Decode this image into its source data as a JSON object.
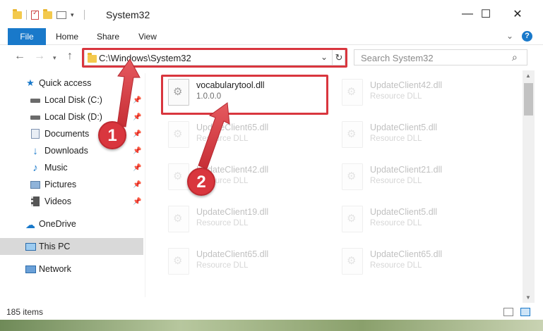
{
  "window": {
    "title": "System32"
  },
  "title_buttons": {
    "minimize": "—",
    "maximize": "☐",
    "close": "✕"
  },
  "ribbon": {
    "tabs": [
      "File",
      "Home",
      "Share",
      "View"
    ],
    "expand": "⌄",
    "help": "?"
  },
  "address": {
    "path": "C:\\Windows\\System32",
    "dropdown": "⌄",
    "refresh": "↻"
  },
  "search": {
    "placeholder": "Search System32"
  },
  "navpane": {
    "items": [
      {
        "label": "Quick access",
        "icon": "star-icon",
        "pinned": false
      },
      {
        "label": "Local Disk (C:)",
        "icon": "drive-icon",
        "pinned": true
      },
      {
        "label": "Local Disk (D:)",
        "icon": "drive-icon",
        "pinned": true
      },
      {
        "label": "Documents",
        "icon": "documents-icon",
        "pinned": true
      },
      {
        "label": "Downloads",
        "icon": "download-icon",
        "pinned": true
      },
      {
        "label": "Music",
        "icon": "music-icon",
        "pinned": true
      },
      {
        "label": "Pictures",
        "icon": "pictures-icon",
        "pinned": true
      },
      {
        "label": "Videos",
        "icon": "videos-icon",
        "pinned": true
      },
      {
        "label": "OneDrive",
        "icon": "cloud-icon",
        "pinned": false
      },
      {
        "label": "This PC",
        "icon": "computer-icon",
        "pinned": false,
        "selected": true
      },
      {
        "label": "Network",
        "icon": "network-icon",
        "pinned": false
      }
    ]
  },
  "files": [
    {
      "name": "vocabularytool.dll",
      "sub": "1.0.0.0",
      "highlighted": true
    },
    {
      "name": "UpdateClient42.dll",
      "sub": "Resource DLL"
    },
    {
      "name": "UpdateClient65.dll",
      "sub": "Resource DLL"
    },
    {
      "name": "UpdateClient5.dll",
      "sub": "Resource DLL"
    },
    {
      "name": "UpdateClient42.dll",
      "sub": "Resource DLL"
    },
    {
      "name": "UpdateClient21.dll",
      "sub": "Resource DLL"
    },
    {
      "name": "UpdateClient19.dll",
      "sub": "Resource DLL"
    },
    {
      "name": "UpdateClient5.dll",
      "sub": "Resource DLL"
    },
    {
      "name": "UpdateClient65.dll",
      "sub": "Resource DLL"
    },
    {
      "name": "UpdateClient65.dll",
      "sub": "Resource DLL"
    }
  ],
  "status": {
    "count": "185 items"
  },
  "annotations": {
    "step1": "1",
    "step2": "2"
  },
  "colors": {
    "accent": "#1979ca",
    "annotation_red": "#d9363e",
    "folder": "#f3c94d"
  }
}
